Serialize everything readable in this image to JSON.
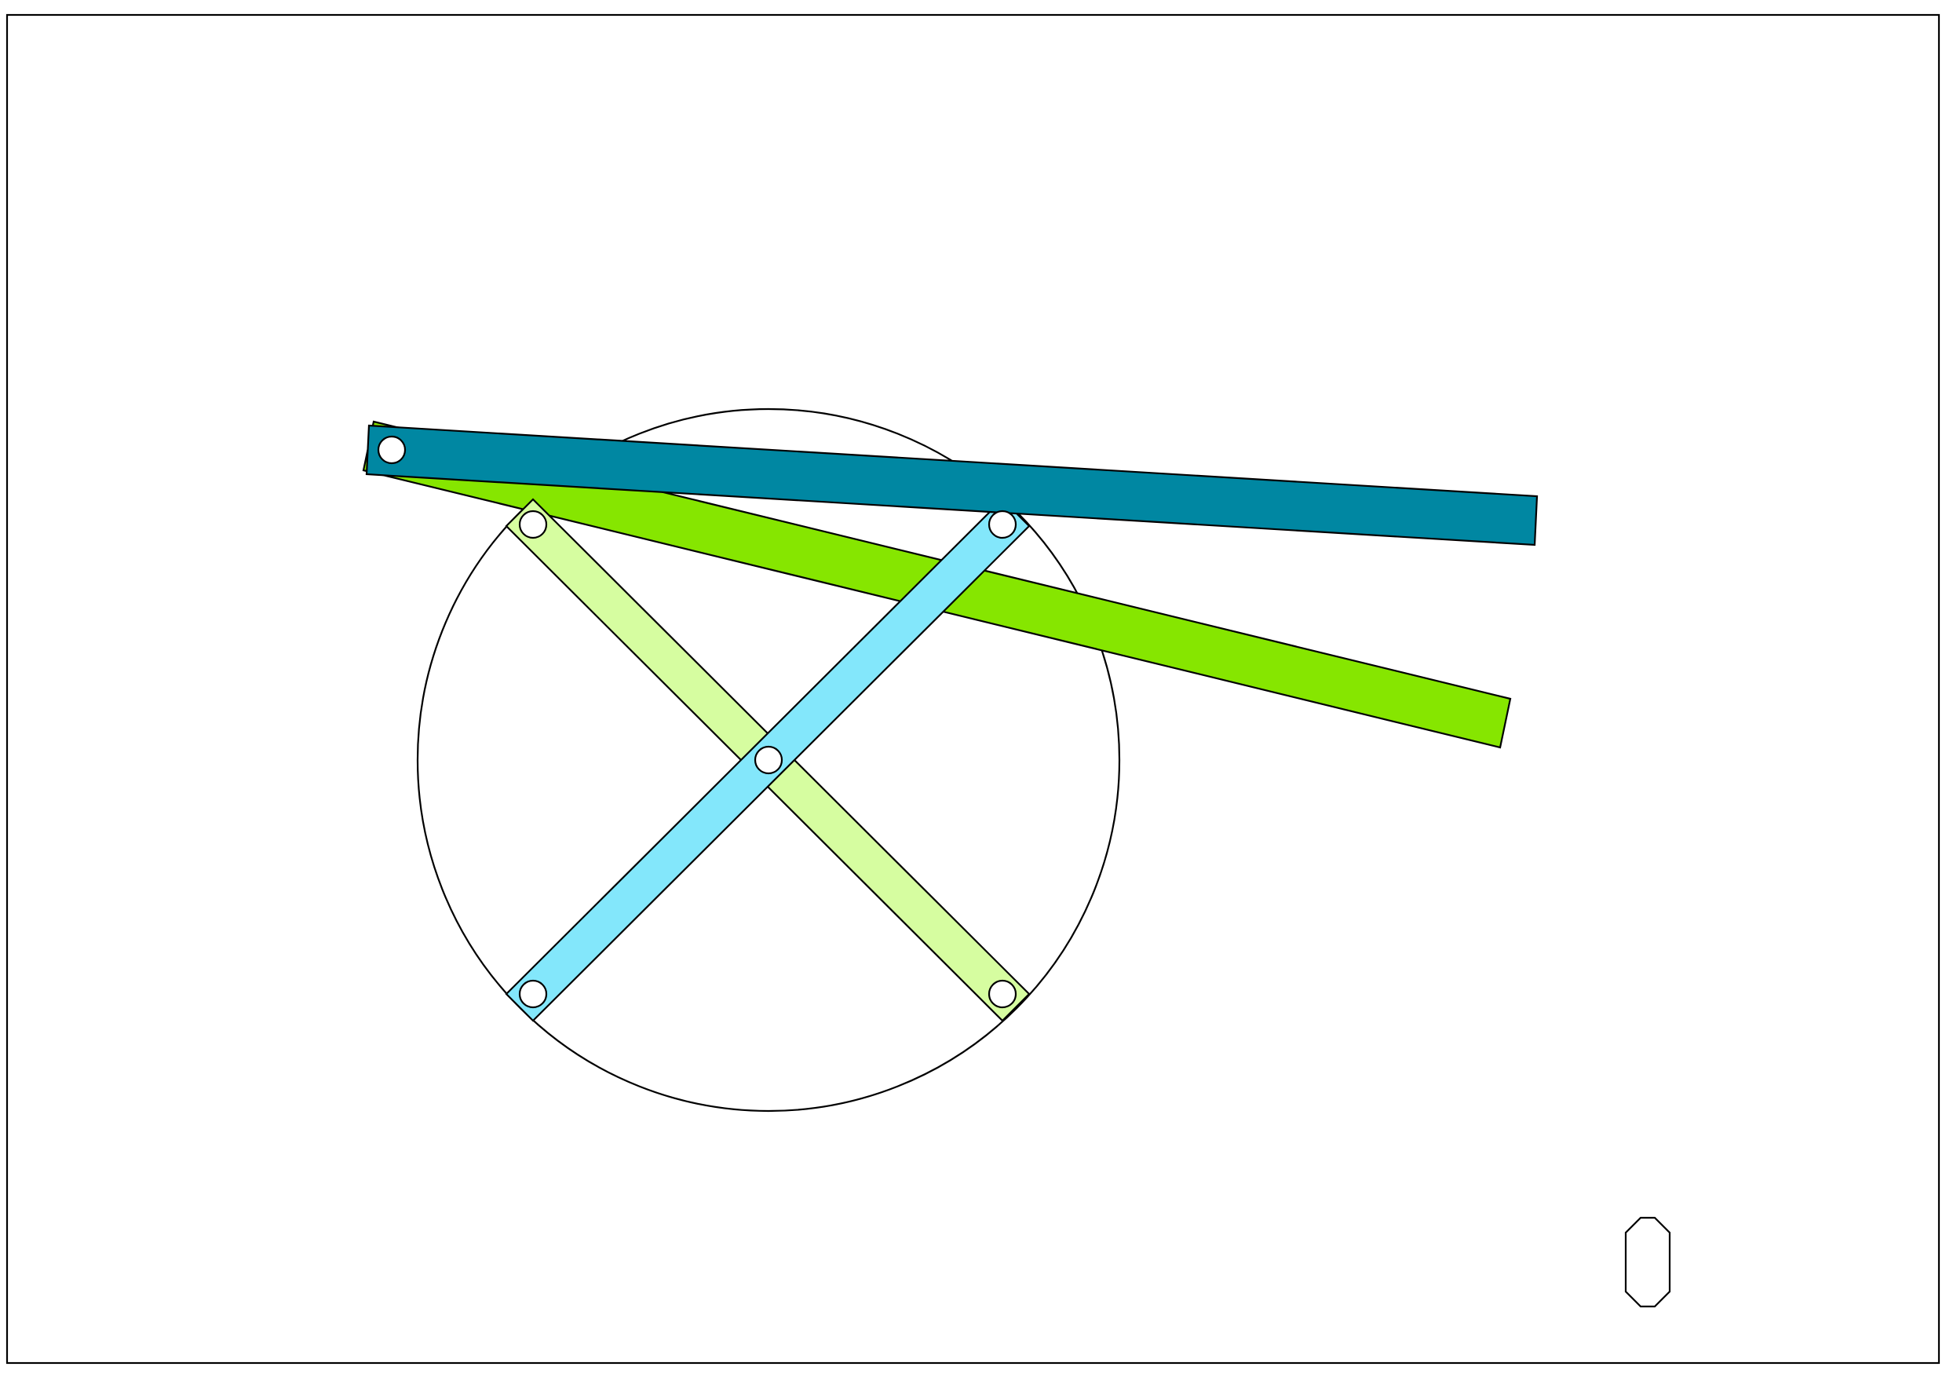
{
  "diagram": {
    "kind": "linkage mechanism",
    "colors": {
      "background": "#ffffff",
      "stroke": "#000000",
      "link_dark_teal": "#0087A2",
      "link_green": "#86E600",
      "link_light_green": "#D6FDA0",
      "link_light_cyan": "#83E7FB",
      "pin_fill": "#ffffff"
    },
    "elements": [
      {
        "name": "reference-circle",
        "shape": "circle"
      },
      {
        "name": "link-green",
        "shape": "bar",
        "color_key": "link_green"
      },
      {
        "name": "link-light-green",
        "shape": "bar",
        "color_key": "link_light_green"
      },
      {
        "name": "link-light-cyan",
        "shape": "bar",
        "color_key": "link_light_cyan"
      },
      {
        "name": "link-dark-teal",
        "shape": "bar",
        "color_key": "link_dark_teal"
      },
      {
        "name": "slider-block",
        "shape": "octagon"
      }
    ],
    "pin_count": 6
  }
}
